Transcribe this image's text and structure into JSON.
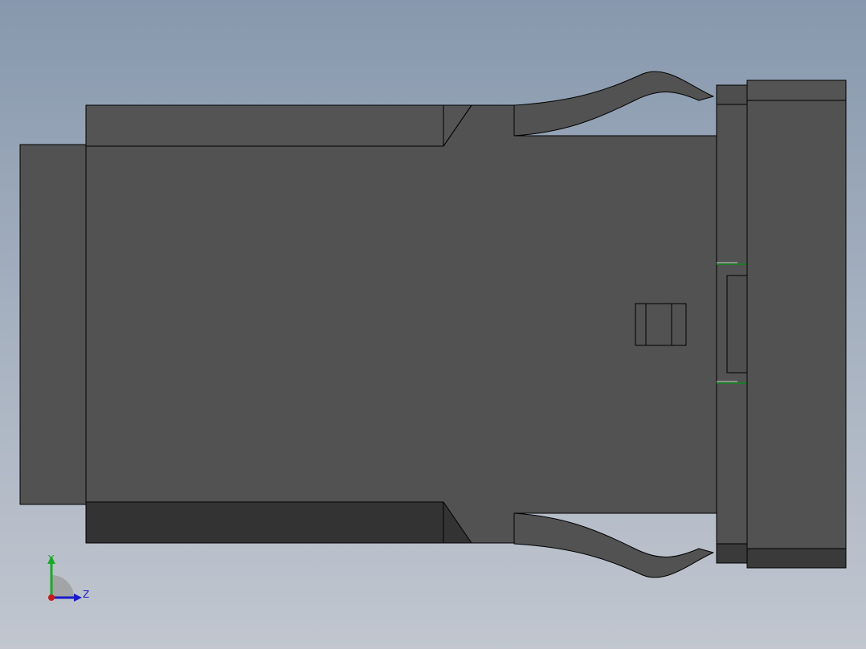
{
  "viewport": {
    "bg_top": "#8798ad",
    "bg_bottom": "#c1c6cf"
  },
  "model": {
    "body_color": "#525252",
    "shadow_color": "#333333",
    "edge_color": "#000000",
    "accent_color": "#1e7a2a"
  },
  "triad": {
    "y_label": "Y",
    "z_label": "Z",
    "y_color": "#1aa82a",
    "z_color": "#1a1ac8",
    "x_color": "#c81a1a"
  }
}
